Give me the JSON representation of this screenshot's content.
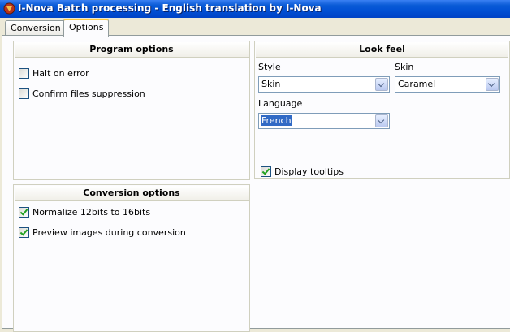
{
  "window": {
    "title": "I-Nova Batch processing - English translation by I-Nova"
  },
  "tabs": [
    {
      "label": "Conversion",
      "active": false
    },
    {
      "label": "Options",
      "active": true
    }
  ],
  "program_options": {
    "title": "Program options",
    "items": [
      {
        "label": "Halt on error",
        "checked": false
      },
      {
        "label": "Confirm files suppression",
        "checked": false
      }
    ]
  },
  "look_feel": {
    "title": "Look feel",
    "style_label": "Style",
    "style_value": "Skin",
    "skin_label": "Skin",
    "skin_value": "Caramel",
    "language_label": "Language",
    "language_value": "French",
    "display_tooltips": {
      "label": "Display tooltips",
      "checked": true
    }
  },
  "conversion_options": {
    "title": "Conversion options",
    "items": [
      {
        "label": "Normalize 12bits to 16bits",
        "checked": true
      },
      {
        "label": "Preview images during conversion",
        "checked": true
      }
    ]
  },
  "icons": {
    "app_icon": "app-icon",
    "dropdown": "chevron-down-icon",
    "checkbox_checked": "checkmark-icon"
  }
}
